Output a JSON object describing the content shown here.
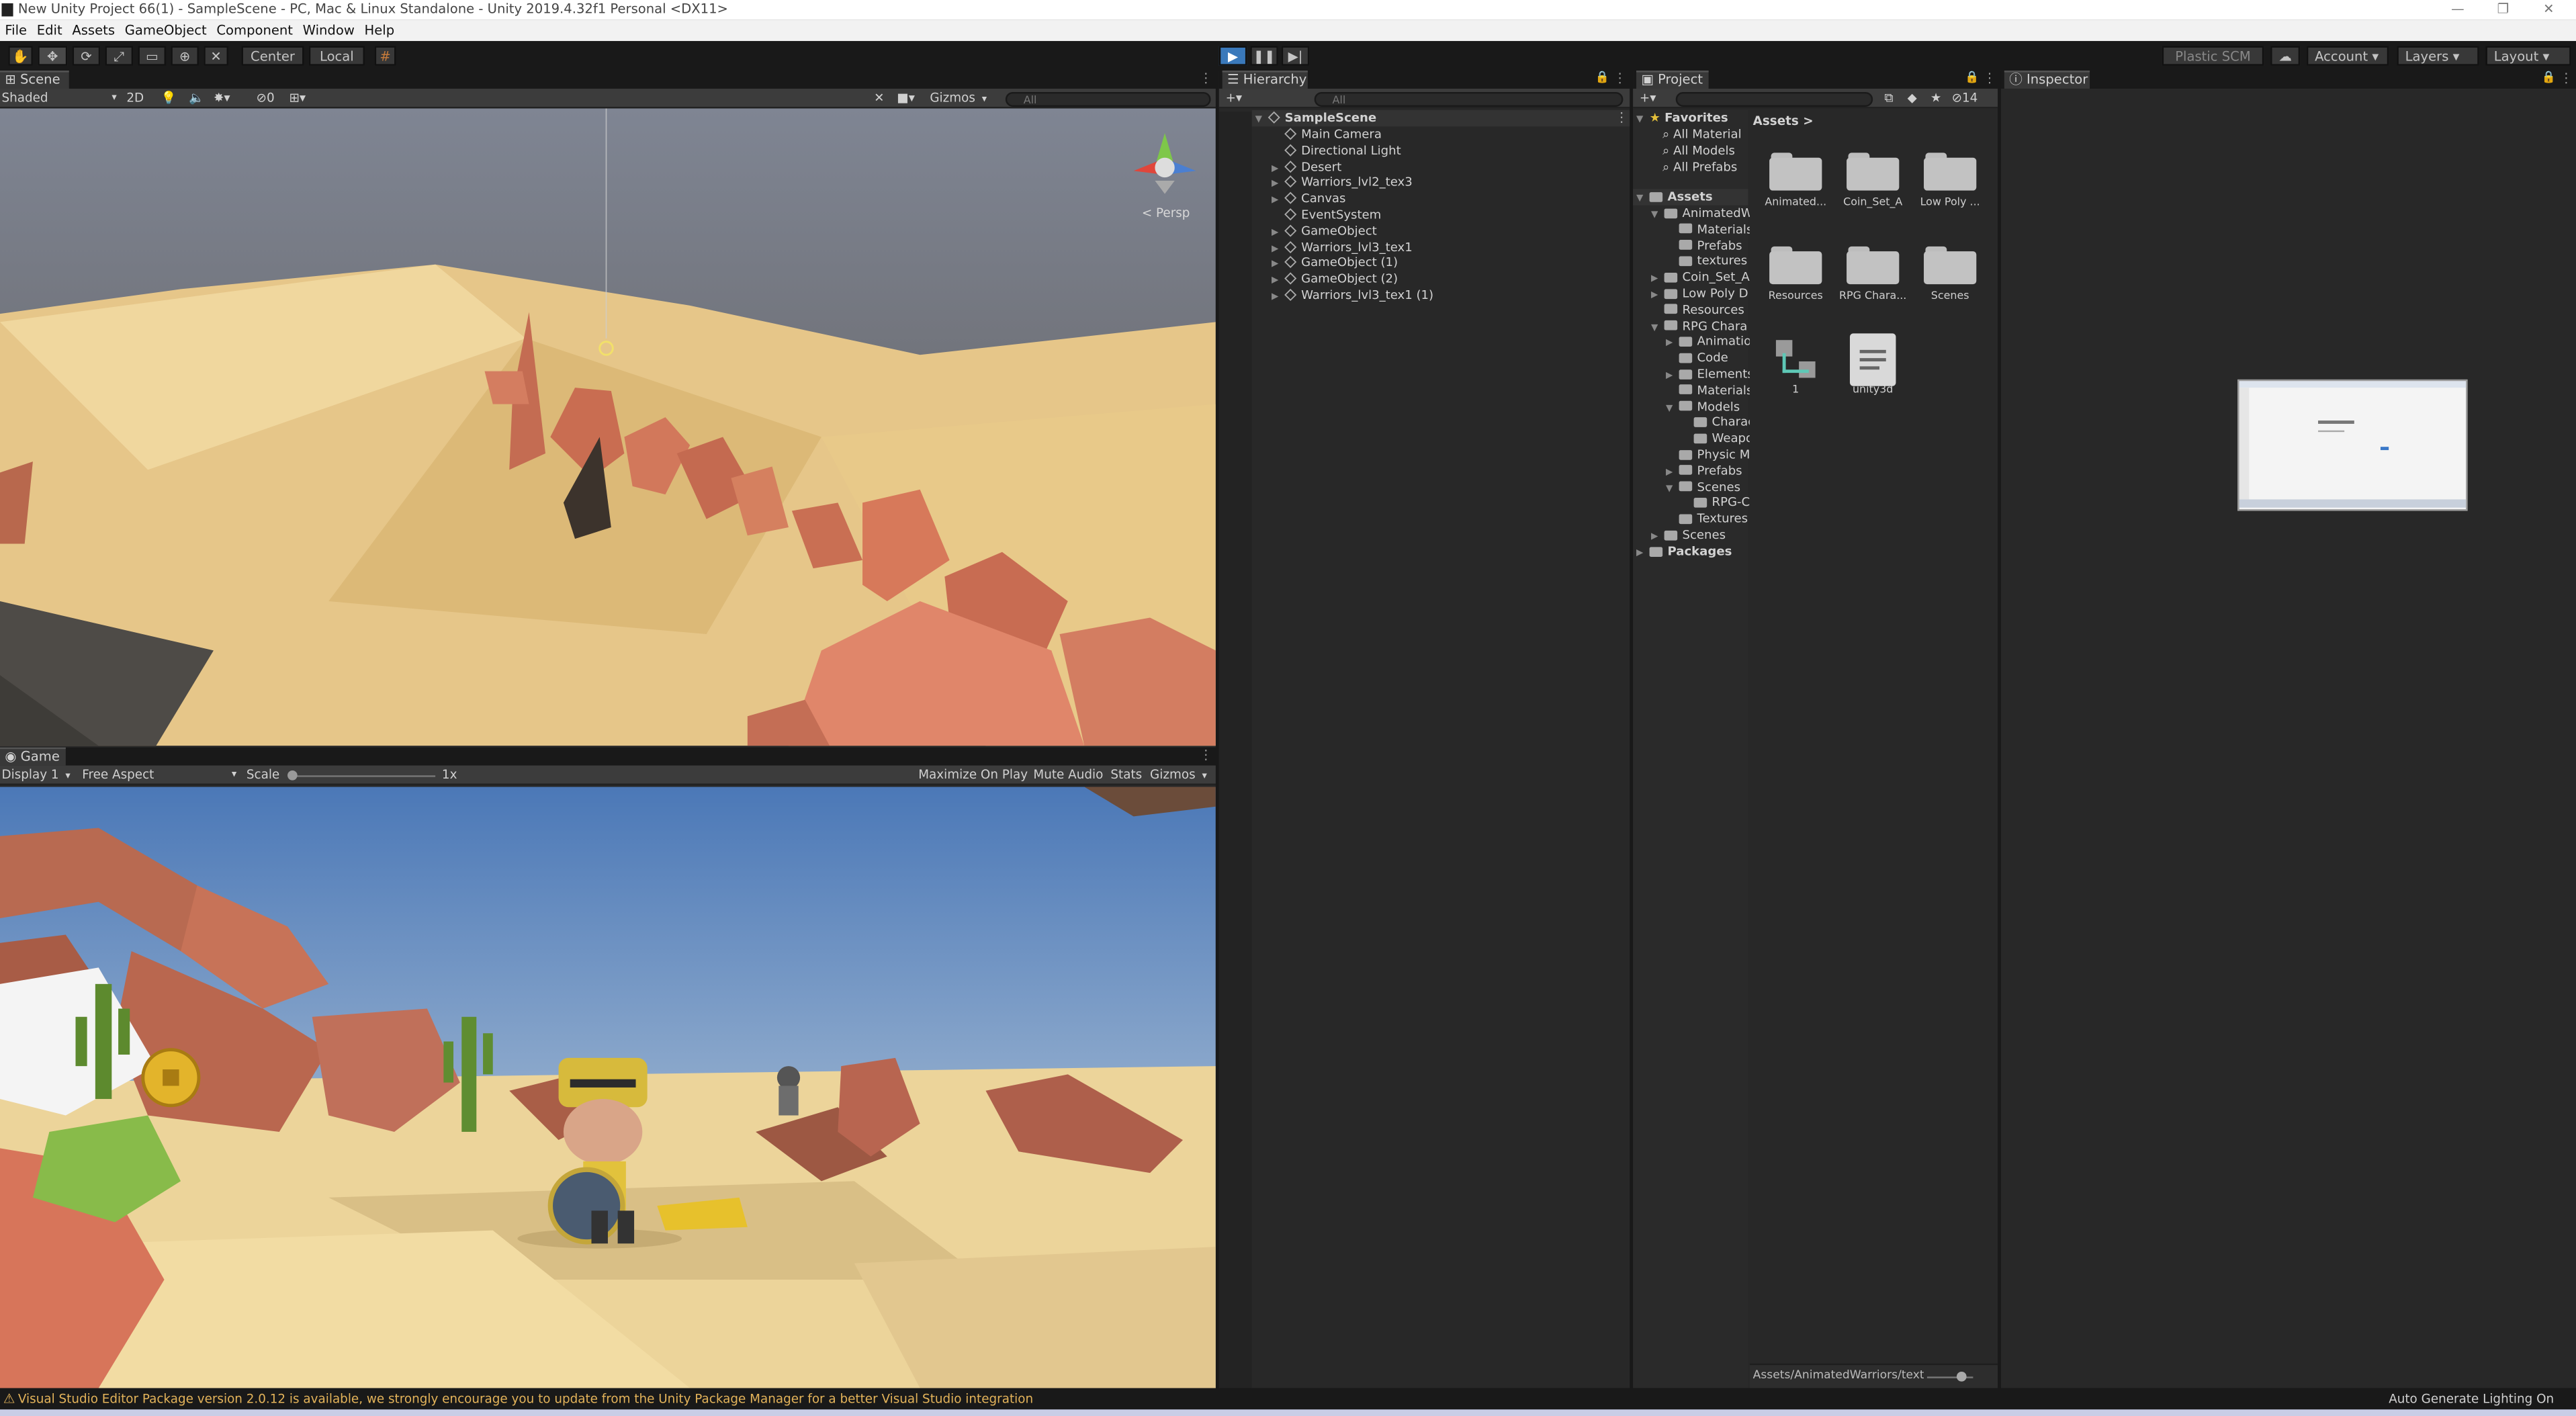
{
  "window": {
    "title": "New Unity Project 66(1) - SampleScene - PC, Mac & Linux Standalone - Unity 2019.4.32f1 Personal <DX11>"
  },
  "menu": [
    "File",
    "Edit",
    "Assets",
    "GameObject",
    "Component",
    "Window",
    "Help"
  ],
  "toolbar": {
    "pivot_center": "Center",
    "pivot_local": "Local",
    "plastic_scm": "Plastic SCM",
    "account": "Account",
    "layers": "Layers",
    "layout": "Layout"
  },
  "scene": {
    "tab": "Scene",
    "shading": "Shaded",
    "mode_2d": "2D",
    "hidden_count": "0",
    "gizmos": "Gizmos",
    "search_placeholder": "All",
    "persp_label": "Persp"
  },
  "game": {
    "tab": "Game",
    "display": "Display 1",
    "aspect": "Free Aspect",
    "scale_label": "Scale",
    "scale_value": "1x",
    "maximize": "Maximize On Play",
    "mute": "Mute Audio",
    "stats": "Stats",
    "gizmos": "Gizmos"
  },
  "hierarchy": {
    "tab": "Hierarchy",
    "search_placeholder": "All",
    "scene_name": "SampleScene",
    "items": [
      {
        "label": "Main Camera",
        "expandable": false
      },
      {
        "label": "Directional Light",
        "expandable": false
      },
      {
        "label": "Desert",
        "expandable": true
      },
      {
        "label": "Warriors_lvl2_tex3",
        "expandable": true
      },
      {
        "label": "Canvas",
        "expandable": true
      },
      {
        "label": "EventSystem",
        "expandable": false
      },
      {
        "label": "GameObject",
        "expandable": true
      },
      {
        "label": "Warriors_lvl3_tex1",
        "expandable": true
      },
      {
        "label": "GameObject (1)",
        "expandable": true
      },
      {
        "label": "GameObject (2)",
        "expandable": true
      },
      {
        "label": "Warriors_lvl3_tex1 (1)",
        "expandable": true
      }
    ]
  },
  "project": {
    "tab": "Project",
    "hidden_count": "14",
    "favorites_label": "Favorites",
    "favorites": [
      "All Material",
      "All Models",
      "All Prefabs"
    ],
    "assets_label": "Assets",
    "tree": [
      {
        "label": "AnimatedW",
        "depth": 1,
        "fold": "open"
      },
      {
        "label": "Materials",
        "depth": 2,
        "fold": ""
      },
      {
        "label": "Prefabs",
        "depth": 2,
        "fold": ""
      },
      {
        "label": "textures",
        "depth": 2,
        "fold": ""
      },
      {
        "label": "Coin_Set_A",
        "depth": 1,
        "fold": "closed"
      },
      {
        "label": "Low Poly D",
        "depth": 1,
        "fold": "closed"
      },
      {
        "label": "Resources",
        "depth": 1,
        "fold": ""
      },
      {
        "label": "RPG Chara",
        "depth": 1,
        "fold": "open"
      },
      {
        "label": "Animatio",
        "depth": 2,
        "fold": "closed"
      },
      {
        "label": "Code",
        "depth": 2,
        "fold": ""
      },
      {
        "label": "Elements",
        "depth": 2,
        "fold": "closed"
      },
      {
        "label": "Materials",
        "depth": 2,
        "fold": ""
      },
      {
        "label": "Models",
        "depth": 2,
        "fold": "open"
      },
      {
        "label": "Charac",
        "depth": 3,
        "fold": ""
      },
      {
        "label": "Weapo",
        "depth": 3,
        "fold": ""
      },
      {
        "label": "Physic M",
        "depth": 2,
        "fold": ""
      },
      {
        "label": "Prefabs",
        "depth": 2,
        "fold": "closed"
      },
      {
        "label": "Scenes",
        "depth": 2,
        "fold": "open"
      },
      {
        "label": "RPG-C",
        "depth": 3,
        "fold": ""
      },
      {
        "label": "Textures",
        "depth": 2,
        "fold": ""
      },
      {
        "label": "Scenes",
        "depth": 1,
        "fold": "closed"
      }
    ],
    "packages_label": "Packages",
    "breadcrumb": "Assets",
    "grid_items": [
      {
        "label": "Animated...",
        "kind": "folder"
      },
      {
        "label": "Coin_Set_A",
        "kind": "folder"
      },
      {
        "label": "Low Poly ...",
        "kind": "folder"
      },
      {
        "label": "Resources",
        "kind": "folder"
      },
      {
        "label": "RPG Chara...",
        "kind": "folder"
      },
      {
        "label": "Scenes",
        "kind": "folder"
      },
      {
        "label": "1",
        "kind": "prefab"
      },
      {
        "label": "unity3d",
        "kind": "file"
      }
    ],
    "footer_path": "Assets/AnimatedWarriors/textu"
  },
  "inspector": {
    "tab": "Inspector"
  },
  "status": {
    "warning": "Visual Studio Editor Package version 2.0.12 is available, we strongly encourage you to update from the Unity Package Manager for a better Visual Studio integration",
    "lighting": "Auto Generate Lighting On"
  }
}
